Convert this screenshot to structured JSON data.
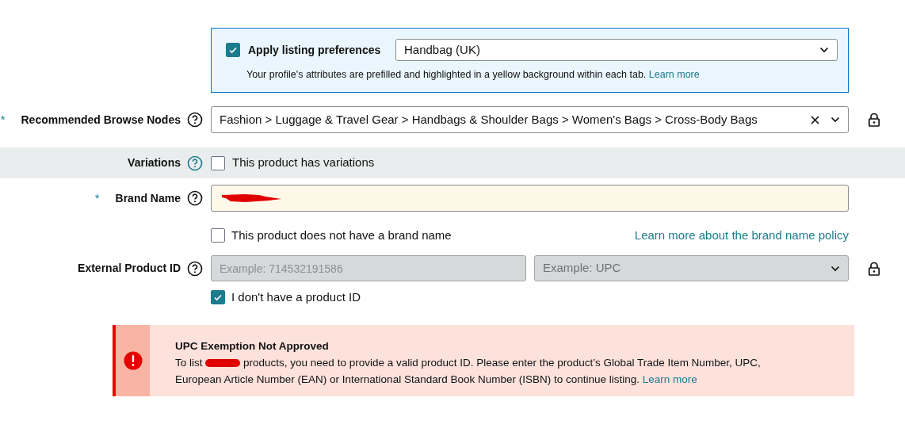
{
  "listing_preferences": {
    "checked": true,
    "label": "Apply listing preferences",
    "value": "Handbag (UK)",
    "note": "Your profile's attributes are prefilled and highlighted in a yellow background within each tab.",
    "note_link": "Learn more"
  },
  "browse_nodes": {
    "required_mark": "*",
    "label": "Recommended Browse Nodes",
    "value": "Fashion > Luggage & Travel Gear > Handbags & Shoulder Bags > Women's Bags > Cross-Body Bags"
  },
  "variations": {
    "label": "Variations",
    "checked": false,
    "option": "This product has variations"
  },
  "brand_name": {
    "required_mark": "*",
    "label": "Brand Name",
    "no_brand": {
      "checked": false,
      "label": "This product does not have a brand name"
    },
    "policy_link": "Learn more about the brand name policy"
  },
  "external_product_id": {
    "label": "External Product ID",
    "placeholder": "Example: 714532191586",
    "type_placeholder": "Example: UPC",
    "no_id": {
      "checked": true,
      "label": "I don't have a product ID"
    }
  },
  "alert": {
    "title": "UPC Exemption Not Approved",
    "text_before": "To list",
    "text_after": "products, you need to provide a valid product ID. Please enter the product’s Global Trade Item Number, UPC, European Article Number (EAN) or International Standard Book Number (ISBN) to continue listing.",
    "link": "Learn more"
  }
}
